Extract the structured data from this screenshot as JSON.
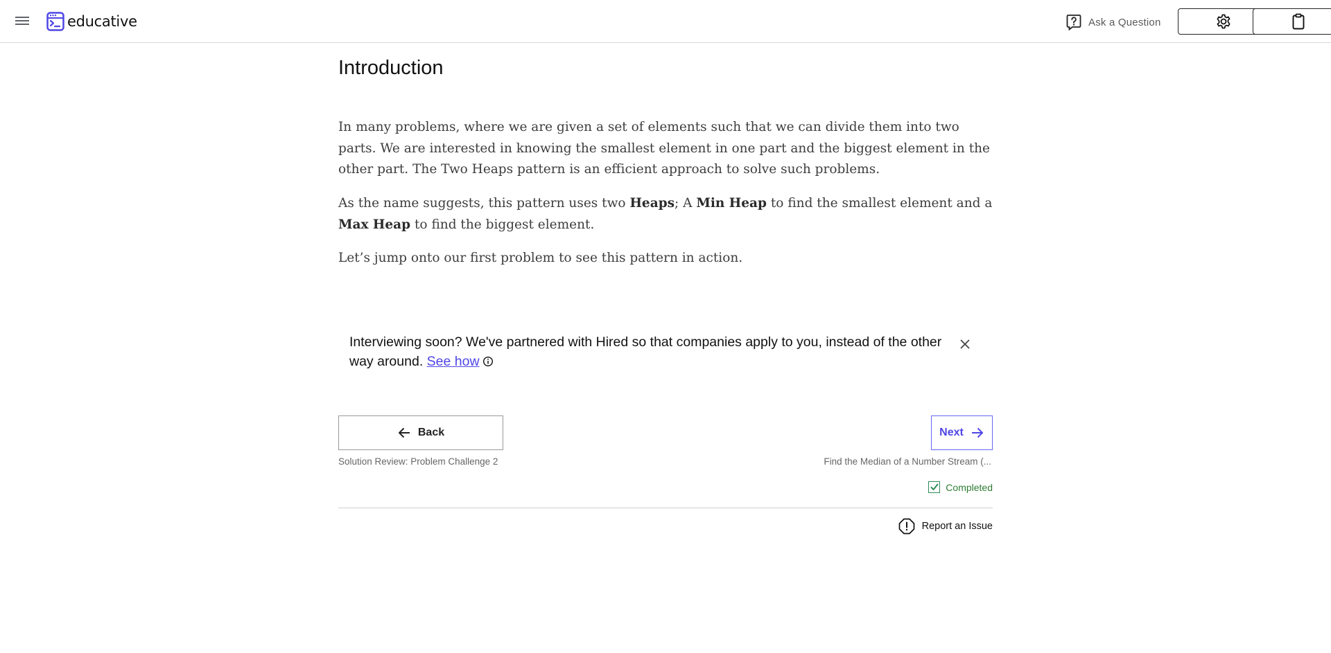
{
  "header": {
    "menu_icon": "hamburger-menu-icon",
    "logo_text": "educative",
    "logo_icon": "educative-logo-icon",
    "ask_label": "Ask a Question",
    "ask_icon": "question-bubble-icon",
    "settings_icon": "gear-icon",
    "clipboard_icon": "clipboard-icon"
  },
  "lesson": {
    "title": "Introduction",
    "paragraph1": "In many problems, where we are given a set of elements such that we can divide them into two parts. We are interested in knowing the smallest element in one part and the biggest element in the other part. The Two Heaps pattern is an efficient approach to solve such problems.",
    "paragraph2": {
      "text1": "As the name suggests, this pattern uses two ",
      "bold1": "Heaps",
      "text2": "; A ",
      "bold2": "Min Heap",
      "text3": " to find the smallest element and a ",
      "bold3": "Max Heap",
      "text4": " to find the biggest element."
    },
    "paragraph3": "Let’s jump onto our first problem to see this pattern in action."
  },
  "promo": {
    "text": "Interviewing soon? We've partnered with Hired so that companies apply to you, instead of the other way around.",
    "link_text": "See how",
    "close_icon": "close-icon",
    "info_icon": "info-icon"
  },
  "navigation": {
    "back_label": "Back",
    "back_subtitle": "Solution Review: Problem Challenge 2",
    "next_label": "Next",
    "next_subtitle": "Find the Median of a Number Stream (...",
    "completed_label": "Completed",
    "completed_checked": true
  },
  "footer": {
    "report_label": "Report an Issue",
    "report_icon": "alert-octagon-icon"
  },
  "colors": {
    "accent": "#4f46e5",
    "completed": "#2e7d32",
    "body_text": "#3d3d3d"
  }
}
